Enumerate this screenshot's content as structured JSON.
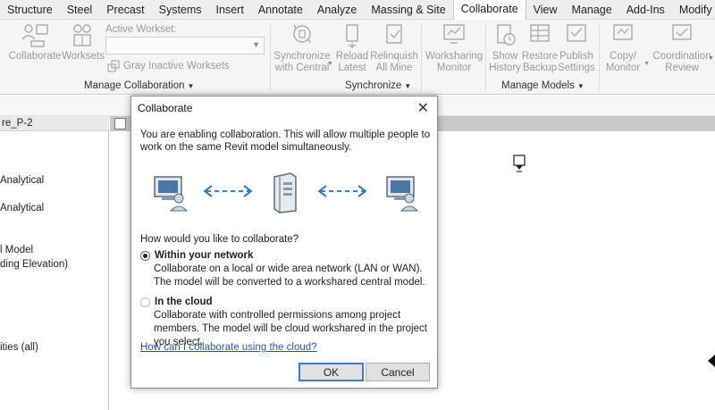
{
  "ribbon_tabs": [
    "Structure",
    "Steel",
    "Precast",
    "Systems",
    "Insert",
    "Annotate",
    "Analyze",
    "Massing & Site",
    "Collaborate",
    "View",
    "Manage",
    "Add-Ins",
    "Modify"
  ],
  "active_tab": "Collaborate",
  "ribbon": {
    "collaborate_label": "Collaborate",
    "worksets_label": "Worksets",
    "active_workset_label": "Active Workset:",
    "gray_inactive_label": "Gray Inactive Worksets",
    "manage_collaboration_label": "Manage Collaboration",
    "sync_central_l1": "Synchronize",
    "sync_central_l2": "with Central",
    "reload_l1": "Reload",
    "reload_l2": "Latest",
    "relinquish_l1": "Relinquish",
    "relinquish_l2": "All Mine",
    "synchronize_label": "Synchronize",
    "ws_monitor_l1": "Worksharing",
    "ws_monitor_l2": "Monitor",
    "show_history_l1": "Show",
    "show_history_l2": "History",
    "restore_l1": "Restore",
    "restore_l2": "Backup",
    "publish_l1": "Publish",
    "publish_l2": "Settings",
    "manage_models_label": "Manage Models",
    "copy_monitor_l1": "Copy/",
    "copy_monitor_l2": "Monitor",
    "coord_review_l1": "Coordination",
    "coord_review_l2": "Review"
  },
  "left_panel": {
    "header": "re_P-2",
    "items": [
      "Analytical",
      "Analytical",
      "l Model",
      "ding Elevation)",
      "ities (all)"
    ]
  },
  "dialog": {
    "title": "Collaborate",
    "intro": "You are enabling collaboration. This will allow multiple people to work on the same Revit model simultaneously.",
    "question": "How would you like to collaborate?",
    "option_network_label": "Within your network",
    "option_network_desc": "Collaborate on a local or wide area network (LAN or WAN). The model will be converted to a workshared central model.",
    "option_cloud_label": "In the cloud",
    "option_cloud_desc": "Collaborate with controlled permissions among project members. The model will be cloud workshared in the project you select.",
    "help_link": "How can I collaborate using the cloud?",
    "ok_label": "OK",
    "cancel_label": "Cancel",
    "selected_option": "Within your network"
  },
  "colors": {
    "link": "#1a5fb4",
    "arrow": "#1f6fc5",
    "ribbon_bg": "#f5f5f5",
    "disabled_text": "#9a9a9a"
  }
}
